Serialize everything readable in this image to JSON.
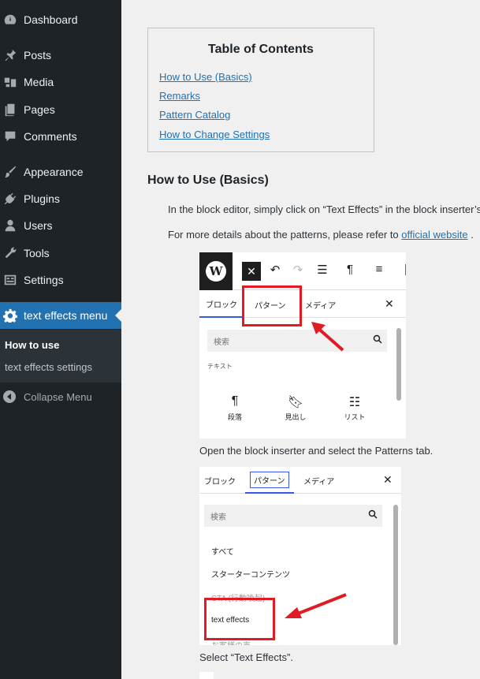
{
  "sidebar": {
    "items": [
      {
        "label": "Dashboard",
        "icon": "dashboard-icon"
      },
      {
        "label": "Posts",
        "icon": "pin-icon"
      },
      {
        "label": "Media",
        "icon": "media-icon"
      },
      {
        "label": "Pages",
        "icon": "pages-icon"
      },
      {
        "label": "Comments",
        "icon": "comment-icon"
      },
      {
        "label": "Appearance",
        "icon": "brush-icon"
      },
      {
        "label": "Plugins",
        "icon": "plugin-icon"
      },
      {
        "label": "Users",
        "icon": "user-icon"
      },
      {
        "label": "Tools",
        "icon": "wrench-icon"
      },
      {
        "label": "Settings",
        "icon": "settings-icon"
      },
      {
        "label": "text effects menu",
        "icon": "gear-icon"
      }
    ],
    "submenu": [
      {
        "label": "How to use"
      },
      {
        "label": "text effects settings"
      }
    ],
    "collapse": "Collapse Menu"
  },
  "colors": {
    "accent": "#2271b1",
    "sidebar_bg": "#1d2327",
    "highlight": "#e01b24"
  },
  "toc": {
    "title": "Table of Contents",
    "links": [
      "How to Use (Basics)",
      "Remarks",
      "Pattern Catalog",
      "How to Change Settings"
    ]
  },
  "section": {
    "heading": "How to Use (Basics)",
    "para1": "In the block editor, simply click on “Text Effects” in the block inserter’s",
    "para2_prefix": "For more details about the patterns, please refer to",
    "para2_link": "official website",
    "para2_suffix": ".",
    "caption1": "Open the block inserter and select the Patterns tab.",
    "caption2": "Select “Text Effects”."
  },
  "shot1": {
    "tabs": [
      "ブロック",
      "パターン",
      "メディア"
    ],
    "search_placeholder": "検索",
    "category": "テキスト",
    "blocks": [
      {
        "icon": "¶",
        "label": "段落"
      },
      {
        "icon": "bookmark",
        "label": "見出し"
      },
      {
        "icon": "list",
        "label": "リスト"
      }
    ]
  },
  "shot2": {
    "tabs": [
      "ブロック",
      "パターン",
      "メディア"
    ],
    "search_placeholder": "検索",
    "categories": [
      "すべて",
      "スターターコンテンツ",
      "CTA (行動喚起)",
      "text effects",
      "お客様の声"
    ]
  }
}
